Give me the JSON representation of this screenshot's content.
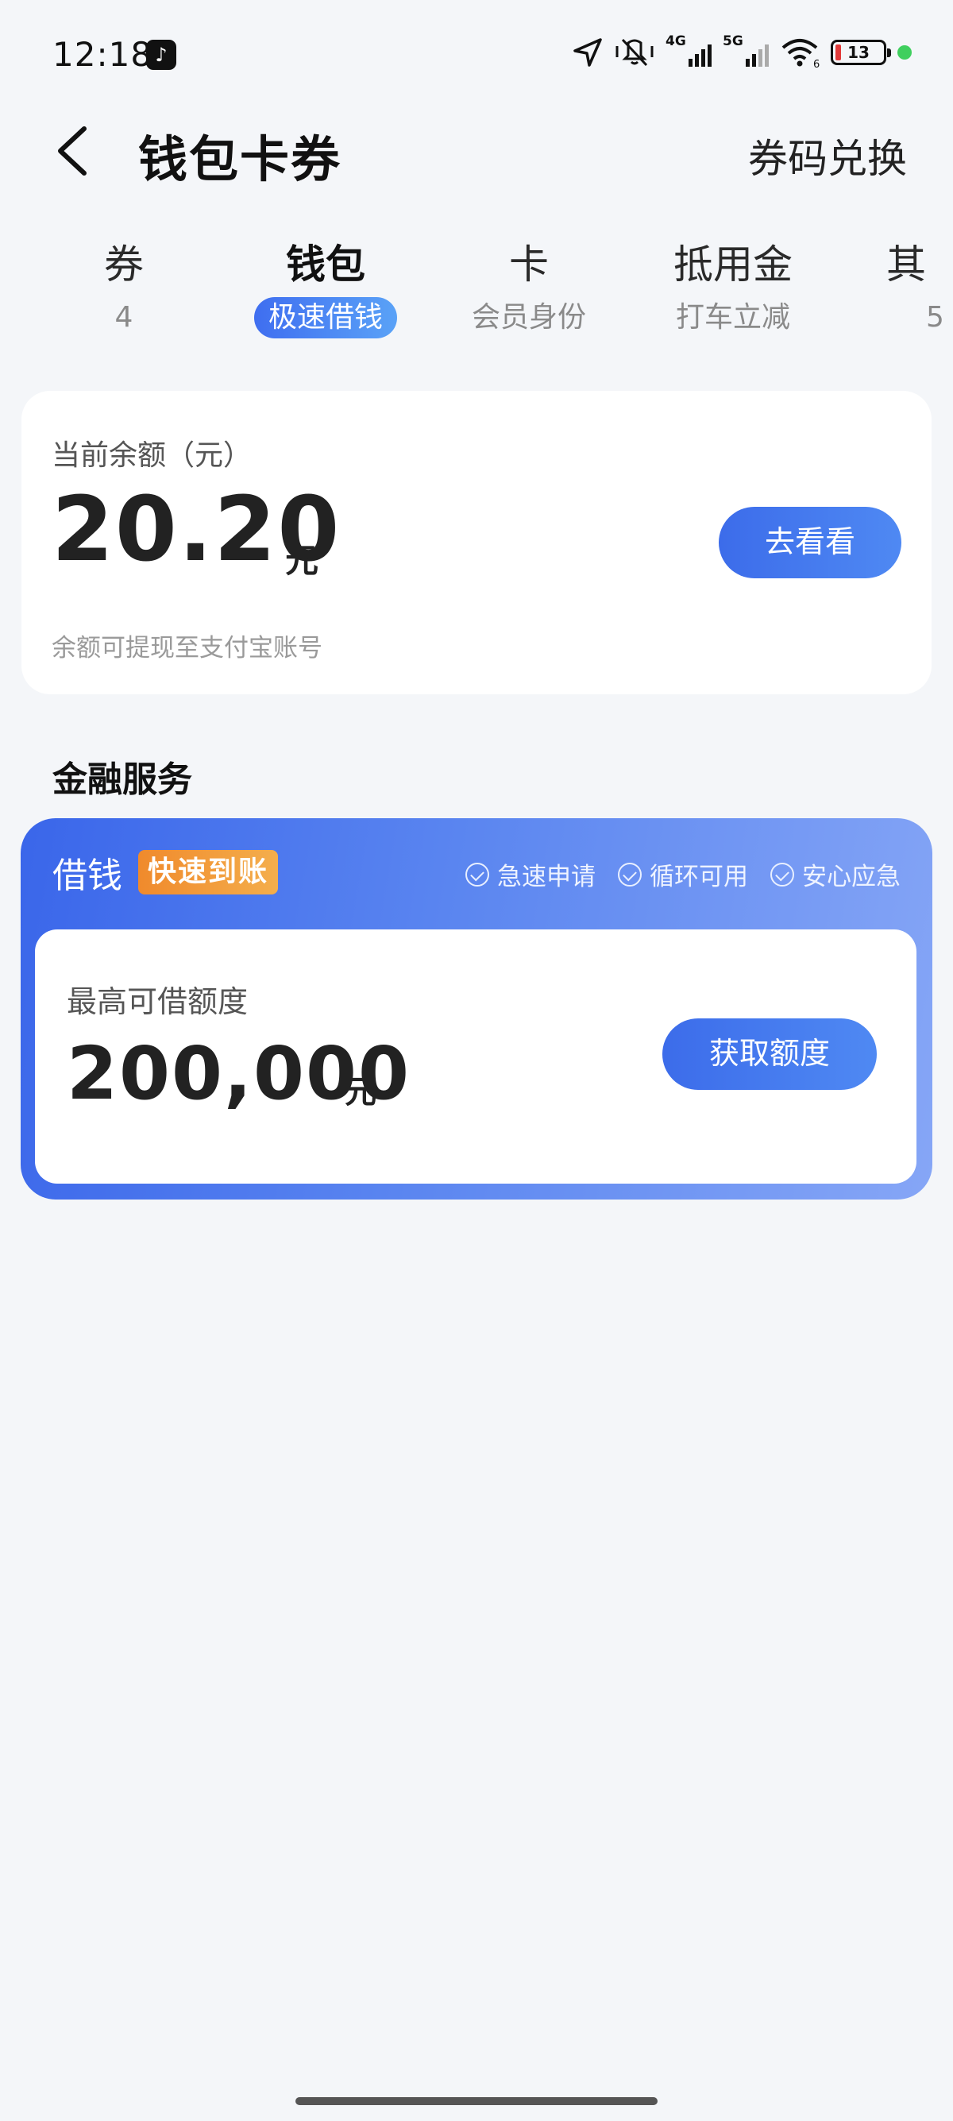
{
  "status_bar": {
    "time": "12:18",
    "app_icon": "tiktok-icon",
    "network_1": "4G",
    "network_2": "5G",
    "wifi_badge": "6",
    "battery": "13",
    "battery_color": "#e23a3a",
    "dot_color": "#3fcf5e"
  },
  "header": {
    "title": "钱包卡券",
    "right_link": "券码兑换"
  },
  "tabs": [
    {
      "label": "券",
      "sub": "4"
    },
    {
      "label": "钱包",
      "sub": "极速借钱",
      "active": true
    },
    {
      "label": "卡",
      "sub": "会员身份"
    },
    {
      "label": "抵用金",
      "sub": "打车立减"
    },
    {
      "label": "其",
      "sub": "5"
    }
  ],
  "balance": {
    "label": "当前余额（元）",
    "amount": "20.20",
    "unit": "元",
    "note": "余额可提现至支付宝账号",
    "button": "去看看"
  },
  "finance": {
    "section_title": "金融服务",
    "card_title": "借钱",
    "badge": "快速到账",
    "features": [
      "急速申请",
      "循环可用",
      "安心应急"
    ],
    "limit_label": "最高可借额度",
    "limit_amount": "200,000",
    "limit_unit": "元",
    "button": "获取额度"
  },
  "colors": {
    "accent": "#3c6cea",
    "badge_orange": "#f08a2c",
    "background": "#f4f6f9"
  }
}
